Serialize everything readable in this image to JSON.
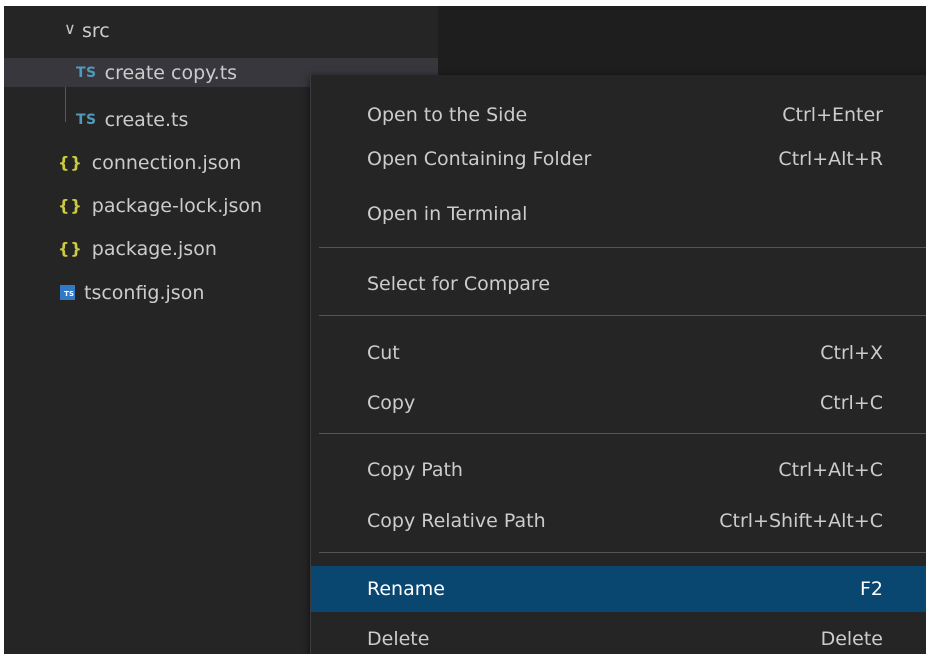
{
  "explorer": {
    "folder": {
      "label": "src",
      "icon": "chevron-down-icon"
    },
    "files": [
      {
        "label": "create copy.ts",
        "icon_text": "TS",
        "icon": "typescript-icon",
        "selected": true
      },
      {
        "label": "create.ts",
        "icon_text": "TS",
        "icon": "typescript-icon"
      },
      {
        "label": "connection.json",
        "icon_text": "{}",
        "icon": "json-icon"
      },
      {
        "label": "package-lock.json",
        "icon_text": "{}",
        "icon": "json-icon"
      },
      {
        "label": "package.json",
        "icon_text": "{}",
        "icon": "json-icon"
      },
      {
        "label": "tsconfig.json",
        "icon_text": "TS",
        "icon": "tsconfig-icon"
      }
    ]
  },
  "context_menu": {
    "items": [
      {
        "label": "Open to the Side",
        "shortcut": "Ctrl+Enter"
      },
      {
        "label": "Open Containing Folder",
        "shortcut": "Ctrl+Alt+R"
      },
      {
        "label": "Open in Terminal",
        "shortcut": ""
      },
      {
        "label": "Select for Compare",
        "shortcut": ""
      },
      {
        "label": "Cut",
        "shortcut": "Ctrl+X"
      },
      {
        "label": "Copy",
        "shortcut": "Ctrl+C"
      },
      {
        "label": "Copy Path",
        "shortcut": "Ctrl+Alt+C"
      },
      {
        "label": "Copy Relative Path",
        "shortcut": "Ctrl+Shift+Alt+C"
      },
      {
        "label": "Rename",
        "shortcut": "F2",
        "highlighted": true
      },
      {
        "label": "Delete",
        "shortcut": "Delete"
      }
    ]
  },
  "colors": {
    "sidebar_bg": "#252526",
    "editor_bg": "#1e1e1e",
    "menu_highlight": "#094771",
    "typescript_icon": "#519aba",
    "json_icon": "#cbcb41"
  }
}
